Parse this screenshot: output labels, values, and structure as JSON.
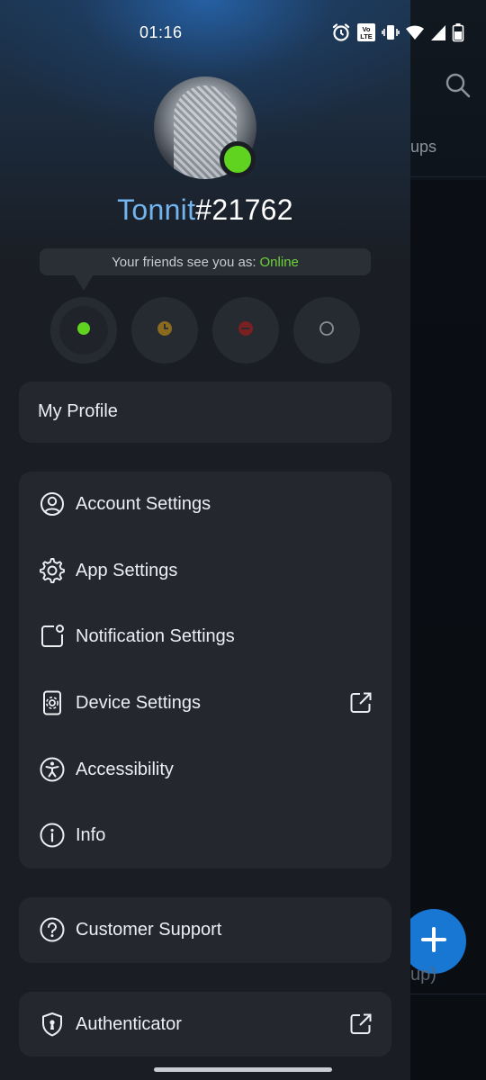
{
  "status_bar": {
    "time": "01:16",
    "icons": [
      "alarm-icon",
      "volte-icon",
      "vibrate-icon",
      "wifi-icon",
      "signal-icon",
      "battery-icon"
    ],
    "volte_text": "Vo LTE"
  },
  "background_app": {
    "tab_partial": "ups",
    "fab_label_partial": "up)",
    "icons": [
      "search-icon",
      "plus-icon"
    ]
  },
  "profile": {
    "username": "Tonnit",
    "tag": "#21762",
    "presence_color": "#5fd31f"
  },
  "status_tip": {
    "prefix": "Your friends see you as:",
    "value": "Online"
  },
  "status_options": [
    {
      "id": "online",
      "color": "#5fd31f",
      "icon": "online-dot-icon",
      "active": true
    },
    {
      "id": "away",
      "color": "#8a6a1f",
      "icon": "clock-icon",
      "active": false
    },
    {
      "id": "busy",
      "color": "#7a1f22",
      "icon": "do-not-disturb-icon",
      "active": false
    },
    {
      "id": "offline",
      "color": "#8a8e95",
      "icon": "offline-circle-icon",
      "active": false
    }
  ],
  "menu": {
    "my_profile": "My Profile",
    "account_settings": "Account Settings",
    "app_settings": "App Settings",
    "notification_settings": "Notification Settings",
    "device_settings": "Device Settings",
    "accessibility": "Accessibility",
    "info": "Info",
    "customer_support": "Customer Support",
    "authenticator": "Authenticator"
  },
  "colors": {
    "drawer_bg": "#1a1d23",
    "card_bg": "#24272e",
    "accent_blue": "#74b4ec",
    "online_green": "#6cd33a",
    "fab_blue": "#1877d2"
  }
}
